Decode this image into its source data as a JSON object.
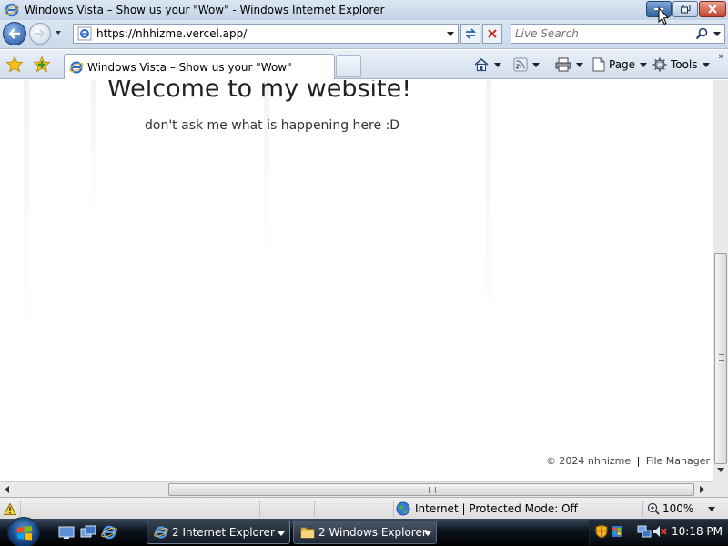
{
  "window": {
    "title": "Windows Vista – Show us your \"Wow\" - Windows Internet Explorer"
  },
  "navigation": {
    "url": "https://nhhizme.vercel.app/",
    "search_placeholder": "Live Search"
  },
  "tabs": [
    {
      "label": "Windows Vista – Show us your \"Wow\""
    }
  ],
  "command_bar": {
    "page_label": "Page",
    "tools_label": "Tools"
  },
  "page": {
    "heading": "Welcome to my website!",
    "subtitle": "don't ask me what is happening here :D",
    "footer_copyright": "© 2024 nhhizme",
    "footer_separator": "|",
    "footer_link": "File Manager"
  },
  "status_bar": {
    "zone": "Internet | Protected Mode: Off",
    "zoom": "100%"
  },
  "taskbar": {
    "tasks": [
      {
        "label": "2 Internet Explorer",
        "icon": "ie-icon",
        "active": true
      },
      {
        "label": "2 Windows Explorer",
        "icon": "folder-icon",
        "active": false
      }
    ],
    "clock": "10:18 PM"
  },
  "colors": {
    "accent": "#1f4f9a",
    "taskbar": "#0c121c",
    "close_button": "#c3452b"
  }
}
